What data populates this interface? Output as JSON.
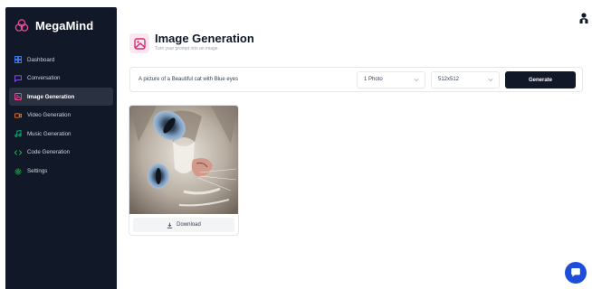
{
  "app": {
    "name": "MegaMind"
  },
  "sidebar": {
    "items": [
      {
        "label": "Dashboard",
        "icon": "dashboard-icon",
        "color": "#3b82f6",
        "active": false
      },
      {
        "label": "Conversation",
        "icon": "message-square-icon",
        "color": "#8b5cf6",
        "active": false
      },
      {
        "label": "Image Generation",
        "icon": "image-icon",
        "color": "#ec4899",
        "active": true
      },
      {
        "label": "Video Generation",
        "icon": "video-icon",
        "color": "#f97316",
        "active": false
      },
      {
        "label": "Music Generation",
        "icon": "music-icon",
        "color": "#10b981",
        "active": false
      },
      {
        "label": "Code Generation",
        "icon": "code-icon",
        "color": "#22c55e",
        "active": false
      },
      {
        "label": "Settings",
        "icon": "settings-icon",
        "color": "#22c55e",
        "active": false
      }
    ]
  },
  "header": {
    "title": "Image Generation",
    "subtitle": "Turn your prompt into an image."
  },
  "prompt": {
    "value": "A picture of a Beautiful cat with Blue eyes",
    "amount": "1 Photo",
    "resolution": "512x512",
    "generate_label": "Generate"
  },
  "results": [
    {
      "download_label": "Download"
    }
  ],
  "colors": {
    "sidebar_bg": "#111827",
    "accent_pink": "#ec4899",
    "primary_button": "#111827",
    "chat_fab": "#1d4ed8"
  }
}
